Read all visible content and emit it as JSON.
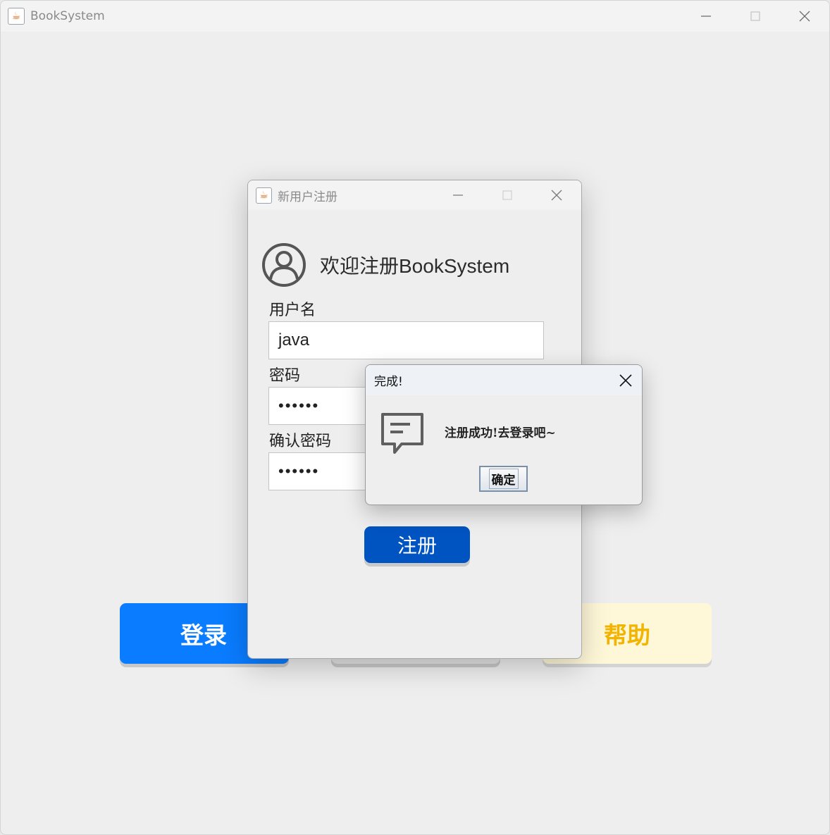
{
  "main_window": {
    "title": "BookSystem",
    "buttons": {
      "login": "登录",
      "register": "",
      "help": "帮助"
    }
  },
  "register_dialog": {
    "title": "新用户注册",
    "welcome": "欢迎注册BookSystem",
    "username_label": "用户名",
    "username_value": "java",
    "password_label": "密码",
    "password_value": "••••••",
    "confirm_label": "确认密码",
    "confirm_value": "••••••",
    "submit_label": "注册"
  },
  "message_dialog": {
    "title": "完成!",
    "message": "注册成功!去登录吧~",
    "ok_label": "确定"
  },
  "colors": {
    "login_button": "#0a7cff",
    "help_button_text": "#f2b400",
    "register_submit": "#0054c1"
  }
}
